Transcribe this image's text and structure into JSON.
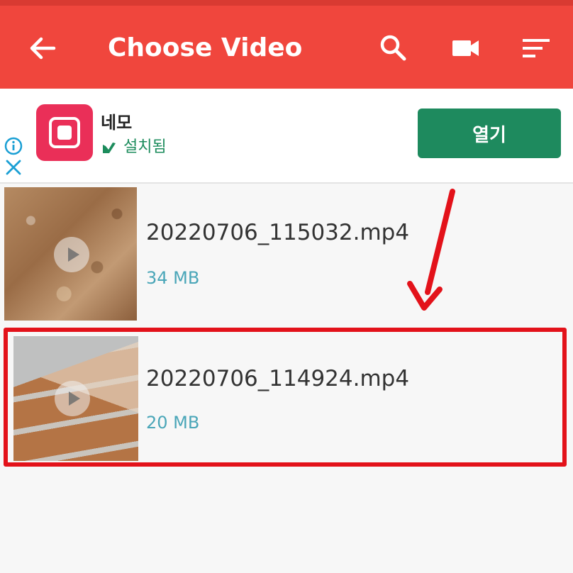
{
  "header": {
    "title": "Choose Video",
    "icons": [
      "back-arrow-icon",
      "search-icon",
      "video-camera-icon",
      "sort-icon"
    ]
  },
  "ad": {
    "app_name": "네모",
    "status": "설치됨",
    "open_button": "열기",
    "icons": [
      "info-icon",
      "close-icon",
      "app-icon",
      "checkmark-icon"
    ]
  },
  "videos": [
    {
      "name": "20220706_115032.mp4",
      "size": "34 MB"
    },
    {
      "name": "20220706_114924.mp4",
      "size": "20 MB"
    }
  ],
  "colors": {
    "header": "#f0463d",
    "ad_button": "#1e8a5e",
    "size_text": "#4aa6b8",
    "highlight": "#e3121a"
  }
}
